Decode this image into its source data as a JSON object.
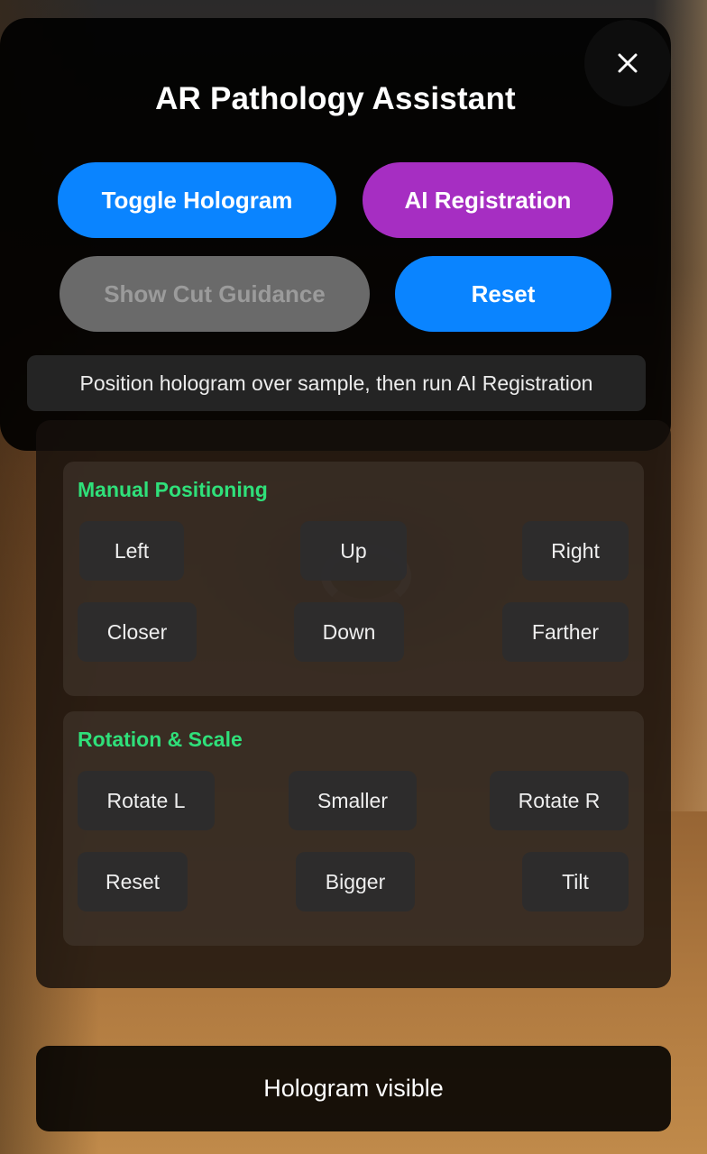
{
  "header": {
    "title": "AR Pathology Assistant",
    "close_icon": "close-icon"
  },
  "actions": {
    "toggle_hologram": "Toggle Hologram",
    "ai_registration": "AI Registration",
    "show_cut_guidance": "Show Cut Guidance",
    "reset": "Reset"
  },
  "instruction": "Position hologram over sample, then run AI Registration",
  "manual_positioning": {
    "title": "Manual Positioning",
    "left": "Left",
    "up": "Up",
    "right": "Right",
    "closer": "Closer",
    "down": "Down",
    "farther": "Farther"
  },
  "rotation_scale": {
    "title": "Rotation & Scale",
    "rotate_l": "Rotate L",
    "smaller": "Smaller",
    "rotate_r": "Rotate R",
    "reset": "Reset",
    "bigger": "Bigger",
    "tilt": "Tilt"
  },
  "status_bar": "Hologram visible",
  "colors": {
    "blue": "#0a84ff",
    "purple": "#a62ec2",
    "disabled": "#6a6a6a",
    "section_title": "#2fe07a"
  }
}
